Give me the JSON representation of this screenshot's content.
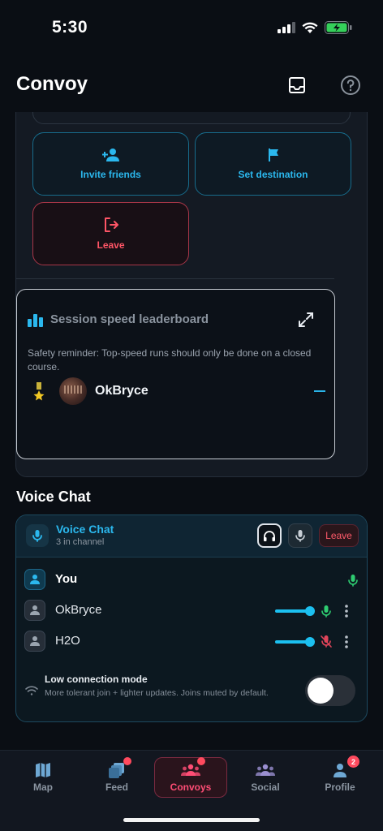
{
  "status": {
    "time": "5:30"
  },
  "header": {
    "title": "Convoy",
    "inbox_icon": "inbox-icon",
    "help_icon": "help-icon"
  },
  "actions": {
    "invite": {
      "label": "Invite friends",
      "icon": "add-person-icon"
    },
    "destination": {
      "label": "Set destination",
      "icon": "flag-icon"
    },
    "leave": {
      "label": "Leave",
      "icon": "exit-icon"
    }
  },
  "leaderboard": {
    "title": "Session speed leaderboard",
    "reminder": "Safety reminder: Top-speed runs should only be done on a closed course.",
    "entries": [
      {
        "name": "OkBryce",
        "value": "—"
      }
    ]
  },
  "voice": {
    "section_title": "Voice Chat",
    "title": "Voice Chat",
    "subtitle": "3 in channel",
    "leave_label": "Leave",
    "members": [
      {
        "name": "You",
        "self": true,
        "mic": "on",
        "volume": null
      },
      {
        "name": "OkBryce",
        "self": false,
        "mic": "on",
        "volume": 0.85
      },
      {
        "name": "H2O",
        "self": false,
        "mic": "muted",
        "volume": 0.85
      }
    ],
    "low_connection": {
      "title": "Low connection mode",
      "description": "More tolerant join + lighter updates. Joins muted by default.",
      "enabled": false
    }
  },
  "tabs": [
    {
      "label": "Map",
      "icon": "map-icon",
      "active": false
    },
    {
      "label": "Feed",
      "icon": "feed-icon",
      "active": false,
      "dot": true
    },
    {
      "label": "Convoys",
      "icon": "group-icon",
      "active": true,
      "dot": true
    },
    {
      "label": "Social",
      "icon": "social-icon",
      "active": false
    },
    {
      "label": "Profile",
      "icon": "profile-icon",
      "active": false,
      "badge": "2"
    }
  ],
  "colors": {
    "accent": "#2bb8ee",
    "danger": "#ff5566",
    "active_tab": "#ff4d75",
    "mic_on": "#2ecc71"
  }
}
